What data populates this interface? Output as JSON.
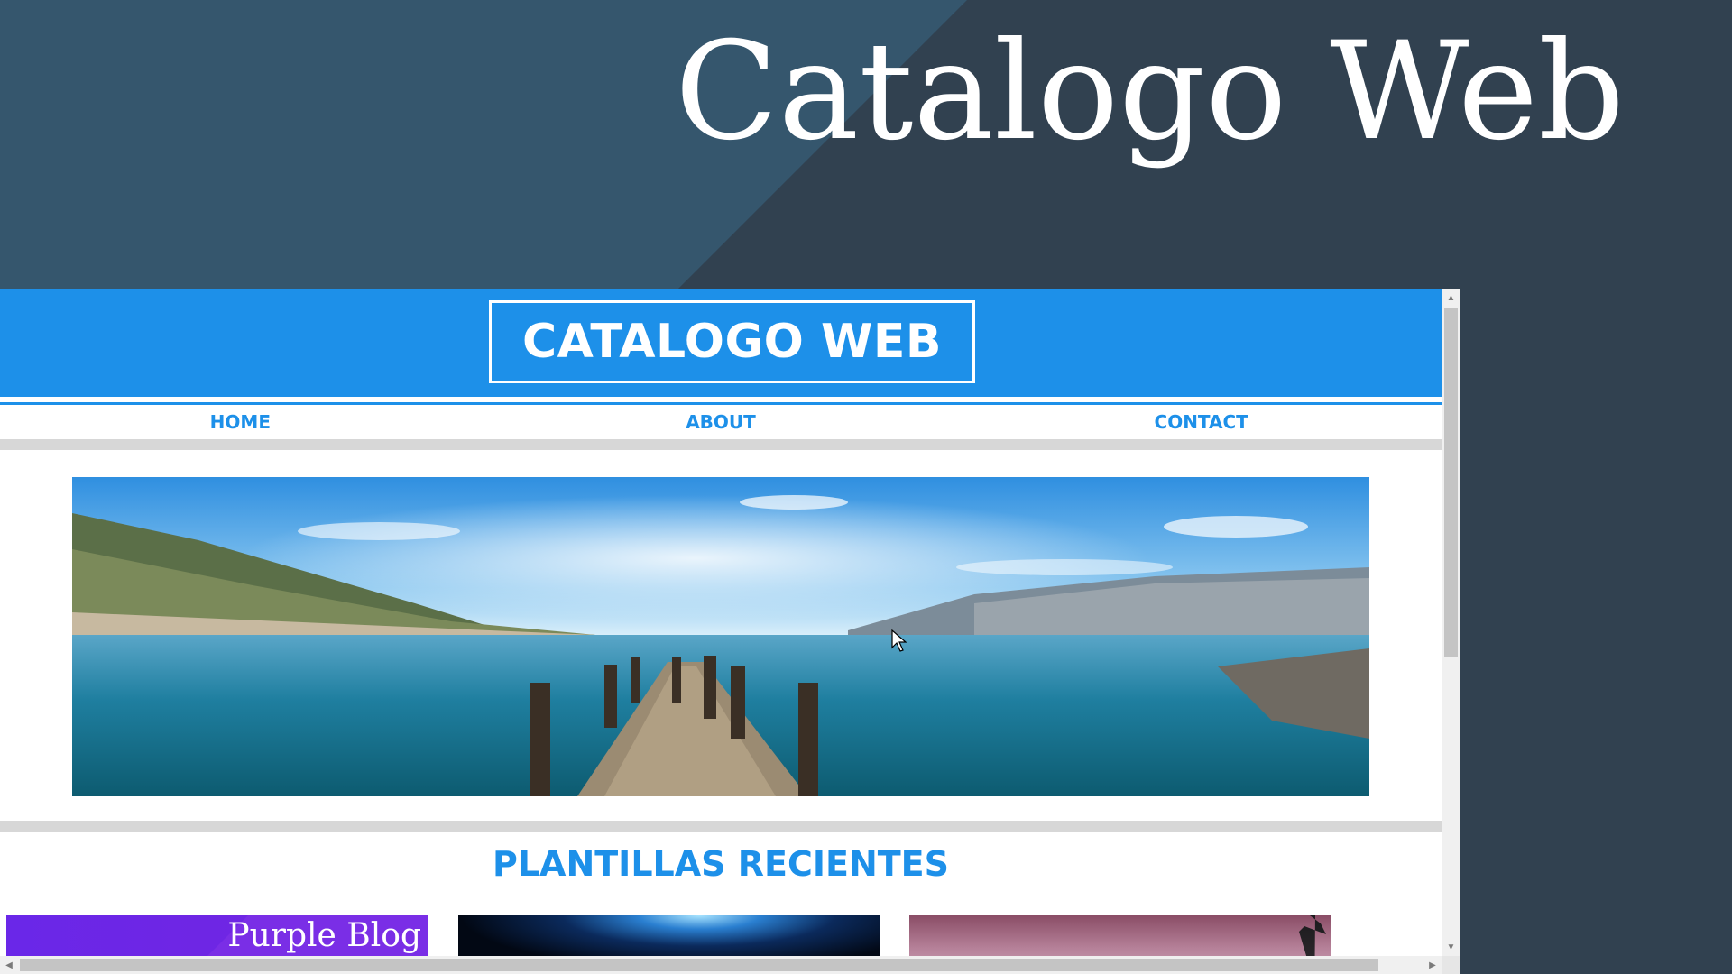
{
  "slide": {
    "title": "Catalogo Web",
    "colors": {
      "background_dark": "#314150",
      "background_light": "#35566d",
      "title": "#ffffff"
    }
  },
  "site": {
    "logo_text": "CATALOGO WEB",
    "accent_color": "#1d90e9",
    "nav": [
      {
        "label": "HOME"
      },
      {
        "label": "ABOUT"
      },
      {
        "label": "CONTACT"
      }
    ],
    "hero_image": "lake-pier-landscape",
    "section_title": "PLANTILLAS RECIENTES",
    "templates": [
      {
        "label": "Purple Blog",
        "theme": "purple"
      },
      {
        "label": "",
        "theme": "dark-blue-space"
      },
      {
        "label": "",
        "theme": "pink-tropical"
      }
    ]
  },
  "scrollbars": {
    "vertical": "scrollbar-vertical",
    "horizontal": "scrollbar-horizontal"
  }
}
